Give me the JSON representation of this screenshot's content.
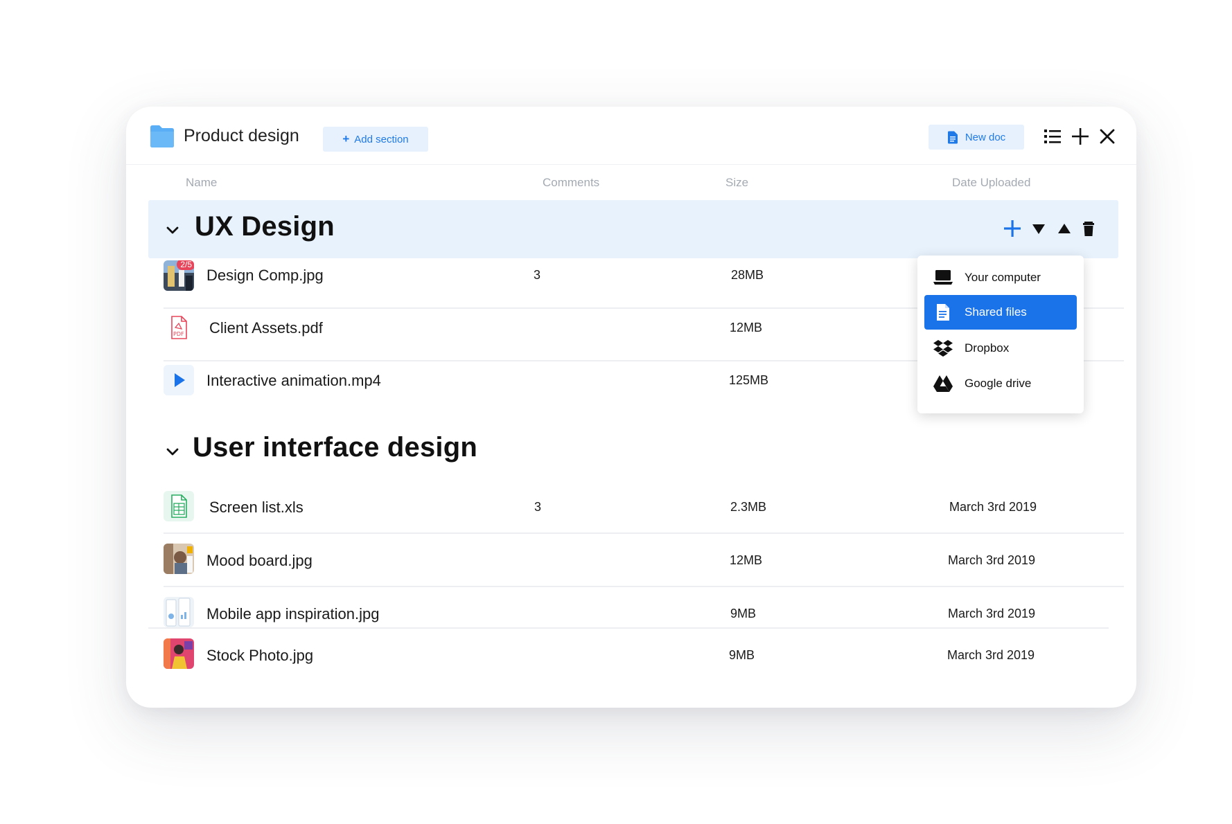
{
  "header": {
    "title": "Product design",
    "add_section_label": "Add section",
    "new_doc_label": "New doc"
  },
  "columns": {
    "name": "Name",
    "comments": "Comments",
    "size": "Size",
    "date": "Date Uploaded"
  },
  "sections": [
    {
      "title": "UX Design",
      "files": [
        {
          "name": "Design Comp.jpg",
          "comments": "3",
          "size": "28MB",
          "date": "",
          "badge": "2/5"
        },
        {
          "name": "Client Assets.pdf",
          "comments": "",
          "size": "12MB",
          "date": ""
        },
        {
          "name": "Interactive animation.mp4",
          "comments": "",
          "size": "125MB",
          "date": ""
        }
      ]
    },
    {
      "title": "User interface design",
      "files": [
        {
          "name": "Screen list.xls",
          "comments": "3",
          "size": "2.3MB",
          "date": "March 3rd 2019"
        },
        {
          "name": "Mood board.jpg",
          "comments": "",
          "size": "12MB",
          "date": "March 3rd 2019"
        },
        {
          "name": "Mobile app inspiration.jpg",
          "comments": "",
          "size": "9MB",
          "date": "March 3rd 2019"
        },
        {
          "name": "Stock Photo.jpg",
          "comments": "",
          "size": "9MB",
          "date": "March 3rd 2019"
        }
      ]
    }
  ],
  "upload_menu": {
    "items": [
      {
        "label": "Your computer",
        "icon": "laptop-icon"
      },
      {
        "label": "Shared files",
        "icon": "document-icon",
        "selected": true
      },
      {
        "label": "Dropbox",
        "icon": "dropbox-icon"
      },
      {
        "label": "Google drive",
        "icon": "google-drive-icon"
      }
    ]
  },
  "colors": {
    "accent": "#1a73e8",
    "band": "#e8f2fd",
    "button_bg": "#e6f1fd",
    "folder": "#5aaef5",
    "badge": "#e8455a"
  }
}
